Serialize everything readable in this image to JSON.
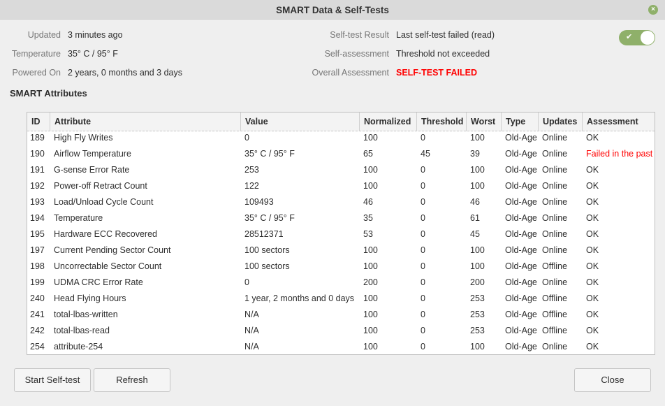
{
  "window": {
    "title": "SMART Data & Self-Tests",
    "close_icon": "close-icon"
  },
  "info": {
    "updated_label": "Updated",
    "updated": "3 minutes ago",
    "temperature_label": "Temperature",
    "temperature": "35° C / 95° F",
    "powered_label": "Powered On",
    "powered": "2 years, 0 months and 3 days",
    "selftest_label": "Self-test Result",
    "selftest": "Last self-test failed (read)",
    "selfassess_label": "Self-assessment",
    "selfassess": "Threshold not exceeded",
    "overall_label": "Overall Assessment",
    "overall": "SELF-TEST FAILED",
    "toggle_on": true
  },
  "section_title": "SMART Attributes",
  "columns": [
    "ID",
    "Attribute",
    "Value",
    "Normalized",
    "Threshold",
    "Worst",
    "Type",
    "Updates",
    "Assessment"
  ],
  "rows": [
    [
      "189",
      "High Fly Writes",
      "0",
      "100",
      "0",
      "100",
      "Old-Age",
      "Online",
      "OK"
    ],
    [
      "190",
      "Airflow Temperature",
      "35° C / 95° F",
      "65",
      "45",
      "39",
      "Old-Age",
      "Online",
      "Failed in the past"
    ],
    [
      "191",
      "G-sense Error Rate",
      "253",
      "100",
      "0",
      "100",
      "Old-Age",
      "Online",
      "OK"
    ],
    [
      "192",
      "Power-off Retract Count",
      "122",
      "100",
      "0",
      "100",
      "Old-Age",
      "Online",
      "OK"
    ],
    [
      "193",
      "Load/Unload Cycle Count",
      "109493",
      "46",
      "0",
      "46",
      "Old-Age",
      "Online",
      "OK"
    ],
    [
      "194",
      "Temperature",
      "35° C / 95° F",
      "35",
      "0",
      "61",
      "Old-Age",
      "Online",
      "OK"
    ],
    [
      "195",
      "Hardware ECC Recovered",
      "28512371",
      "53",
      "0",
      "45",
      "Old-Age",
      "Online",
      "OK"
    ],
    [
      "197",
      "Current Pending Sector Count",
      "100 sectors",
      "100",
      "0",
      "100",
      "Old-Age",
      "Online",
      "OK"
    ],
    [
      "198",
      "Uncorrectable Sector Count",
      "100 sectors",
      "100",
      "0",
      "100",
      "Old-Age",
      "Offline",
      "OK"
    ],
    [
      "199",
      "UDMA CRC Error Rate",
      "0",
      "200",
      "0",
      "200",
      "Old-Age",
      "Online",
      "OK"
    ],
    [
      "240",
      "Head Flying Hours",
      "1 year, 2 months and 0 days",
      "100",
      "0",
      "253",
      "Old-Age",
      "Offline",
      "OK"
    ],
    [
      "241",
      "total-lbas-written",
      "N/A",
      "100",
      "0",
      "253",
      "Old-Age",
      "Offline",
      "OK"
    ],
    [
      "242",
      "total-lbas-read",
      "N/A",
      "100",
      "0",
      "253",
      "Old-Age",
      "Offline",
      "OK"
    ],
    [
      "254",
      "attribute-254",
      "N/A",
      "100",
      "0",
      "100",
      "Old-Age",
      "Online",
      "OK"
    ]
  ],
  "colors": {
    "accent": "#8fb06a",
    "failed": "#ff0000"
  },
  "buttons": {
    "start": "Start Self-test",
    "refresh": "Refresh",
    "close": "Close"
  }
}
